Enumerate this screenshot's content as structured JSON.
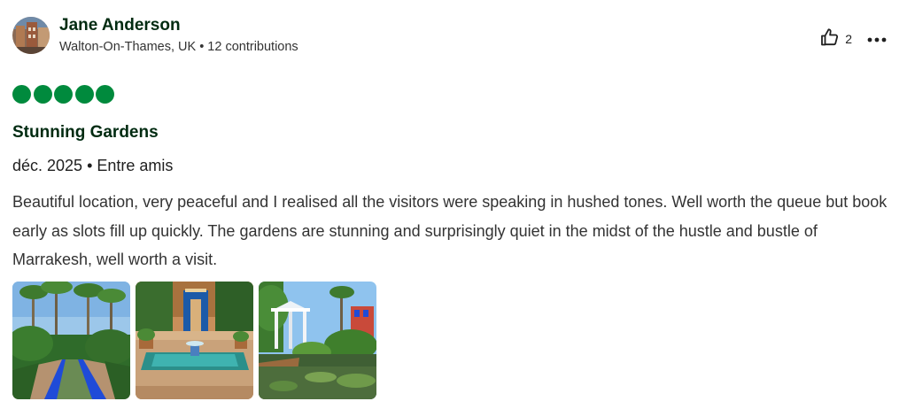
{
  "review": {
    "author": {
      "name": "Jane Anderson",
      "location": "Walton-On-Thames, UK",
      "contributions": "12 contributions",
      "meta": "Walton-On-Thames, UK • 12 contributions"
    },
    "helpful_count": "2",
    "rating": 5,
    "title": "Stunning Gardens",
    "date_line": "déc. 2025 • Entre amis",
    "body": "Beautiful location, very peaceful and I realised all the visitors were speaking in hushed tones. Well worth the queue but book early as slots fill up quickly. The gardens are stunning and surprisingly quiet in the midst of the hustle and bustle of Marrakesh, well worth a visit.",
    "photos": [
      {
        "subject": "palm-garden-blue-canal"
      },
      {
        "subject": "courtyard-fountain"
      },
      {
        "subject": "gazebo-pond"
      }
    ]
  },
  "colors": {
    "rating_green": "#008a3d",
    "title_dark_green": "#002b11",
    "majorelle_blue": "#1f4bd8"
  },
  "icons": {
    "helpful": "thumbs-up-icon",
    "more": "more-options-icon"
  }
}
